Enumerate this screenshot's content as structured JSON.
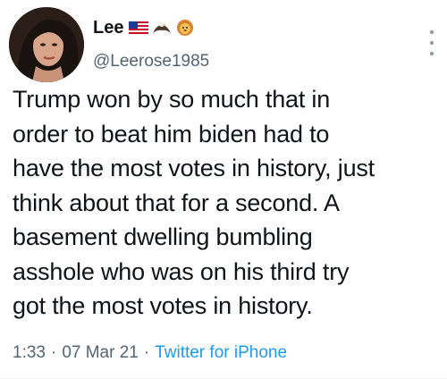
{
  "user": {
    "display_name": "Lee",
    "handle": "@Leerose1985",
    "badges": [
      "us-flag-icon",
      "eagle-icon",
      "lion-icon"
    ]
  },
  "tweet": {
    "lines": [
      "Trump won by so much that in",
      "order to beat him biden had to",
      "have the most votes in history, just",
      "think about that for a second. A",
      "basement dwelling bumbling",
      "asshole who was on his third try",
      "got the most votes in history."
    ]
  },
  "meta": {
    "time": "1:33",
    "separator": "·",
    "date": "07 Mar 21",
    "source": "Twitter for iPhone"
  },
  "colors": {
    "accent": "#1d9bf0",
    "secondary_text": "#536471",
    "primary_text": "#0f1419"
  }
}
